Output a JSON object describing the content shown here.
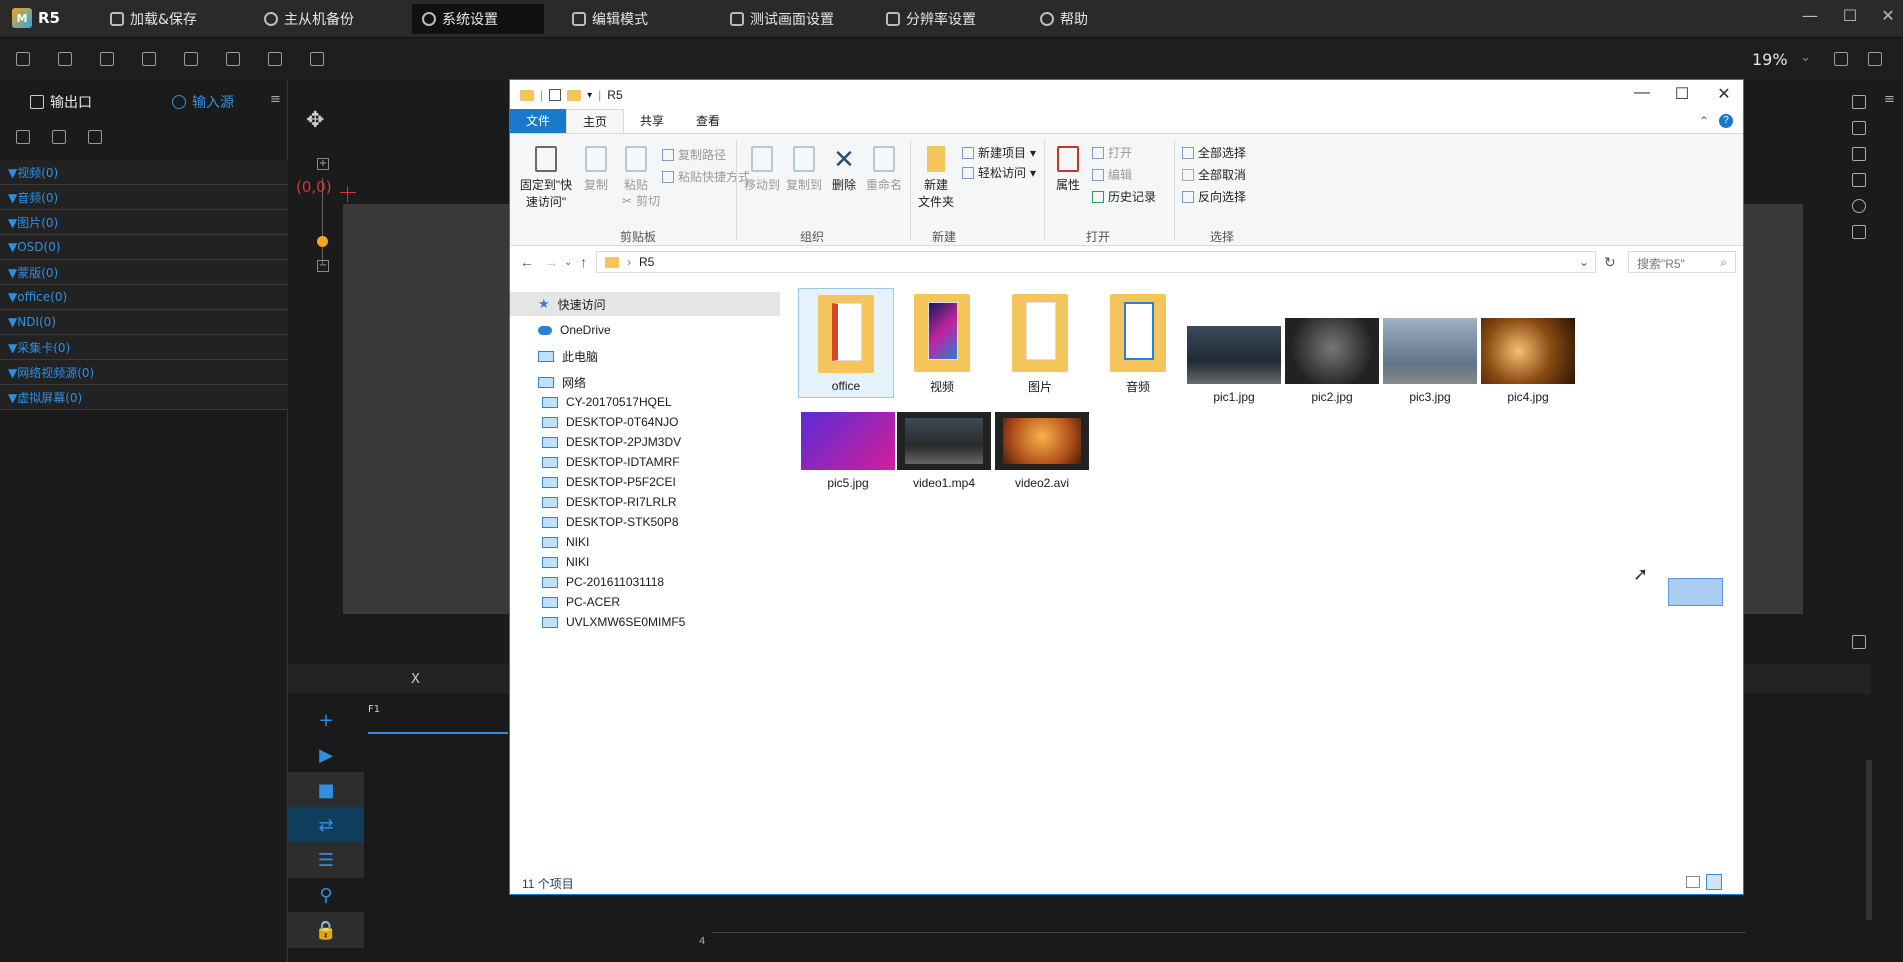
{
  "app": {
    "name": "R5",
    "menu": [
      "加载&保存",
      "主从机备份",
      "系统设置",
      "编辑模式",
      "测试画面设置",
      "分辨率设置",
      "帮助"
    ],
    "zoom": "19%"
  },
  "left_panel": {
    "tab_output": "输出口",
    "tab_input": "输入源",
    "tree": [
      "▼视频(0)",
      "▼音频(0)",
      "▼图片(0)",
      "▼OSD(0)",
      "▼蒙版(0)",
      "▼office(0)",
      "▼NDI(0)",
      "▼采集卡(0)",
      "▼网络视频源(0)",
      "▼虚拟屏幕(0)"
    ]
  },
  "canvas": {
    "origin": "(0,0)"
  },
  "timeline": {
    "x_label": "X",
    "track": "F1",
    "frame_num": "4"
  },
  "explorer": {
    "title": "R5",
    "tabs": [
      "文件",
      "主页",
      "共享",
      "查看"
    ],
    "ribbon": {
      "pin": "固定到\"快速访问\"",
      "copy": "复制",
      "paste": "粘贴",
      "copy_path": "复制路径",
      "paste_shortcut": "粘贴快捷方式",
      "cut": "剪切",
      "group_clipboard": "剪贴板",
      "move_to": "移动到",
      "copy_to": "复制到",
      "delete": "删除",
      "rename": "重命名",
      "group_organize": "组织",
      "new_folder": "新建\n文件夹",
      "new_item": "新建项目",
      "easy_access": "轻松访问",
      "group_new": "新建",
      "properties": "属性",
      "open": "打开",
      "edit": "编辑",
      "history": "历史记录",
      "group_open": "打开",
      "select_all": "全部选择",
      "select_none": "全部取消",
      "invert": "反向选择",
      "group_select": "选择"
    },
    "address": "R5",
    "search_placeholder": "搜索\"R5\"",
    "nav": {
      "quick_access": "快速访问",
      "onedrive": "OneDrive",
      "this_pc": "此电脑",
      "network": "网络",
      "computers": [
        "CY-20170517HQEL",
        "DESKTOP-0T64NJO",
        "DESKTOP-2PJM3DV",
        "DESKTOP-IDTAMRF",
        "DESKTOP-P5F2CEI",
        "DESKTOP-RI7LRLR",
        "DESKTOP-STK50P8",
        "NIKI",
        "NIKI",
        "PC-201611031118",
        "PC-ACER",
        "UVLXMW6SE0MIMF5"
      ]
    },
    "items": [
      "office",
      "视频",
      "图片",
      "音频",
      "pic1.jpg",
      "pic2.jpg",
      "pic3.jpg",
      "pic4.jpg",
      "pic5.jpg",
      "video1.mp4",
      "video2.avi"
    ],
    "status": "11 个项目"
  }
}
